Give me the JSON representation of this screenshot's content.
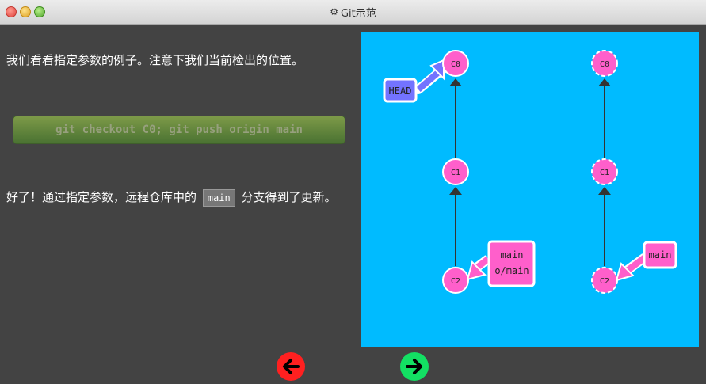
{
  "window": {
    "title": "Git示范"
  },
  "left_panel": {
    "intro_text": "我们看看指定参数的例子。注意下我们当前检出的位置。",
    "command_label": "git checkout C0; git push origin main",
    "result_text_before": "好了！通过指定参数，远程仓库中的",
    "result_code": "main",
    "result_text_after": "分支得到了更新。"
  },
  "graph": {
    "local": {
      "commits": [
        "C0",
        "C1",
        "C2"
      ],
      "head_label": "HEAD",
      "branch_labels": [
        "main",
        "o/main"
      ]
    },
    "remote": {
      "commits": [
        "C0",
        "C1",
        "C2"
      ],
      "branch_label": "main"
    }
  },
  "colors": {
    "background": "#434343",
    "canvas": "#00bbff",
    "commit": "#ff5fcb",
    "head": "#7373ff",
    "back_button": "#ff2020",
    "forward_button": "#13e063"
  }
}
